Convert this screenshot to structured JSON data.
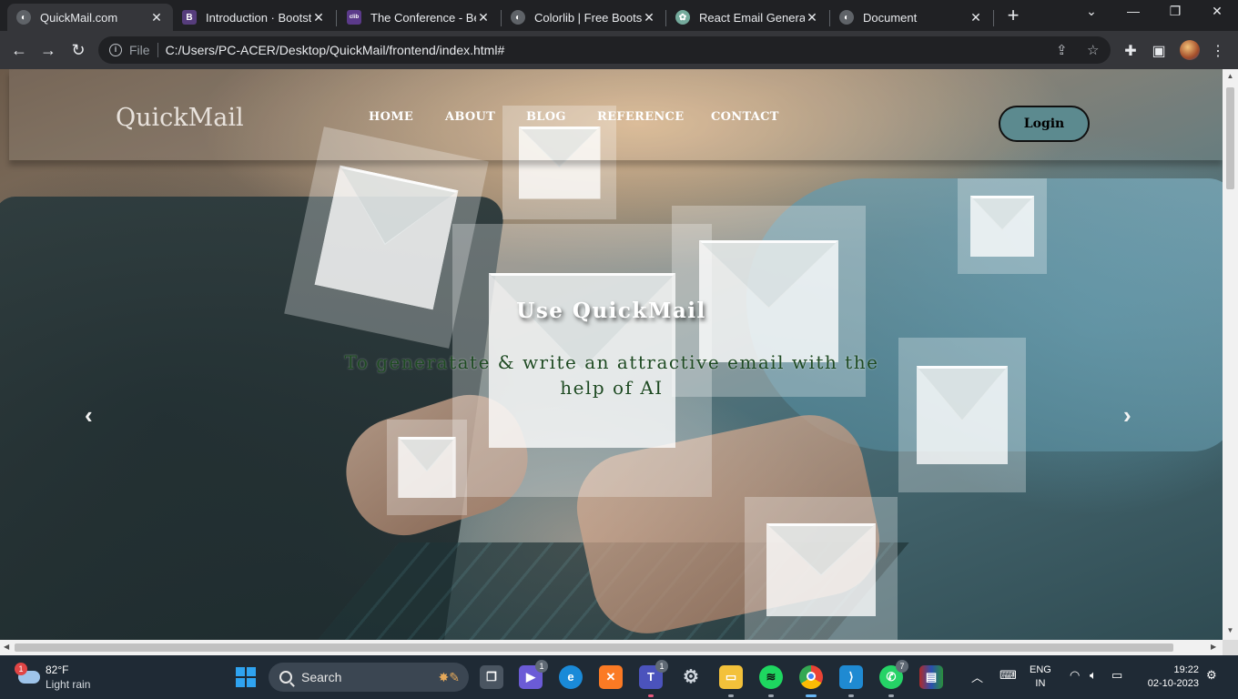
{
  "browser": {
    "tabs": [
      {
        "title": "QuickMail.com",
        "active": true,
        "favicon": "globe-icon"
      },
      {
        "title": "Introduction · Bootstr",
        "active": false,
        "favicon": "bootstrap-icon"
      },
      {
        "title": "The Conference - Bes",
        "active": false,
        "favicon": "colorlib-icon"
      },
      {
        "title": "Colorlib | Free Bootst",
        "active": false,
        "favicon": "globe-icon"
      },
      {
        "title": "React Email Generato",
        "active": false,
        "favicon": "openai-icon"
      },
      {
        "title": "Document",
        "active": false,
        "favicon": "globe-icon"
      }
    ],
    "address": {
      "scheme_label": "File",
      "url": "C:/Users/PC-ACER/Desktop/QuickMail/frontend/index.html#"
    }
  },
  "site": {
    "brand": "QuickMail",
    "nav": [
      "HOME",
      "ABOUT",
      "BLOG",
      "REFERENCE",
      "CONTACT"
    ],
    "login_label": "Login",
    "hero": {
      "title": "Use QuickMail",
      "subtitle": "To generatate & write an attractive email with the help of AI"
    },
    "carousel_prev": "‹",
    "carousel_next": "›"
  },
  "taskbar": {
    "weather": {
      "temp": "82°F",
      "condition": "Light rain",
      "badge": "1"
    },
    "search_placeholder": "Search",
    "apps": [
      {
        "name": "task-view-icon",
        "badge": ""
      },
      {
        "name": "meet-icon",
        "badge": "1"
      },
      {
        "name": "edge-icon",
        "badge": ""
      },
      {
        "name": "xampp-icon",
        "badge": ""
      },
      {
        "name": "teams-icon",
        "badge": "1"
      },
      {
        "name": "settings-icon",
        "badge": ""
      },
      {
        "name": "file-explorer-icon",
        "badge": ""
      },
      {
        "name": "spotify-icon",
        "badge": ""
      },
      {
        "name": "chrome-icon",
        "badge": ""
      },
      {
        "name": "vscode-icon",
        "badge": ""
      },
      {
        "name": "whatsapp-icon",
        "badge": "7"
      },
      {
        "name": "winrar-icon",
        "badge": ""
      }
    ],
    "language": {
      "line1": "ENG",
      "line2": "IN"
    },
    "time": "19:22",
    "date": "02-10-2023"
  },
  "colors": {
    "login_bg": "#5c8a8f",
    "subtitle": "#1e4a22",
    "taskbar": "#1f2a35",
    "chrome_dark": "#202124",
    "chrome_toolbar": "#35363a"
  }
}
